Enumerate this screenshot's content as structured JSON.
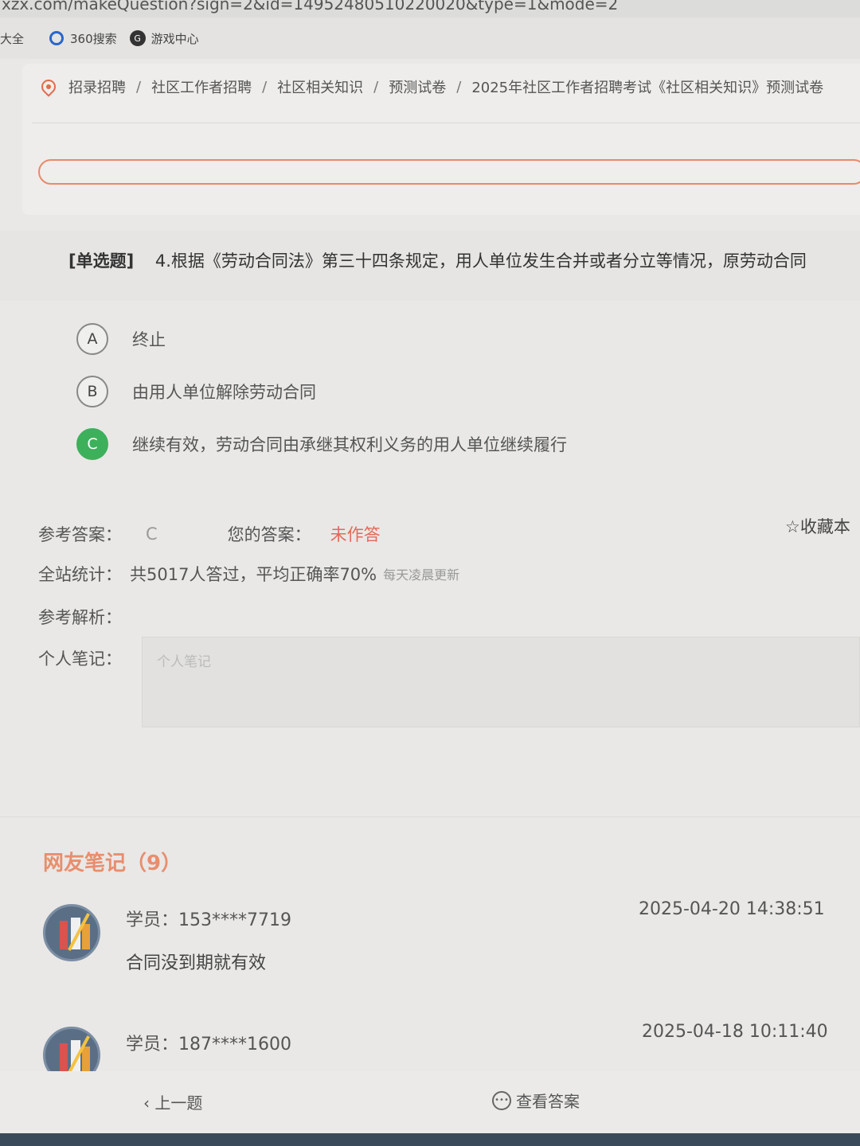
{
  "browser": {
    "url_fragment": "xzx.com/makeQuestion?sign=2&id=14952480510220020&type=1&mode=2",
    "bookmarks": [
      "大全",
      "360搜索",
      "游戏中心"
    ]
  },
  "breadcrumb": {
    "items": [
      "招录招聘",
      "社区工作者招聘",
      "社区相关知识",
      "预测试卷",
      "2025年社区工作者招聘考试《社区相关知识》预测试卷"
    ],
    "separator": "/"
  },
  "progress": {
    "value": 1.0,
    "color": "#e88a6a"
  },
  "question": {
    "type": "[单选题]",
    "text": "4.根据《劳动合同法》第三十四条规定，用人单位发生合并或者分立等情况，原劳动合同"
  },
  "options": [
    {
      "letter": "A",
      "text": "终止",
      "correct": false
    },
    {
      "letter": "B",
      "text": "由用人单位解除劳动合同",
      "correct": false
    },
    {
      "letter": "C",
      "text": "继续有效，劳动合同由承继其权利义务的用人单位继续履行",
      "correct": true
    }
  ],
  "answer": {
    "reference_label": "参考答案：",
    "reference_value": "C",
    "yours_label": "您的答案：",
    "yours_value": "未作答",
    "favorite_label": "收藏本"
  },
  "stats": {
    "label": "全站统计：",
    "text": "共5017人答过，平均正确率70%",
    "note": "每天凌晨更新"
  },
  "analysis": {
    "label": "参考解析："
  },
  "note": {
    "label": "个人笔记：",
    "placeholder": "个人笔记"
  },
  "comments": {
    "title": "网友笔记（9）",
    "items": [
      {
        "user": "学员：153****7719",
        "time": "2025-04-20 14:38:51",
        "text": "合同没到期就有效"
      },
      {
        "user": "学员：187****1600",
        "time": "2025-04-18 10:11:40",
        "text": ""
      }
    ]
  },
  "nav": {
    "prev": "上一题",
    "view_answer": "查看答案"
  },
  "colors": {
    "accent": "#e88a6a",
    "correct": "#3db05c",
    "warning": "#e5685c"
  }
}
